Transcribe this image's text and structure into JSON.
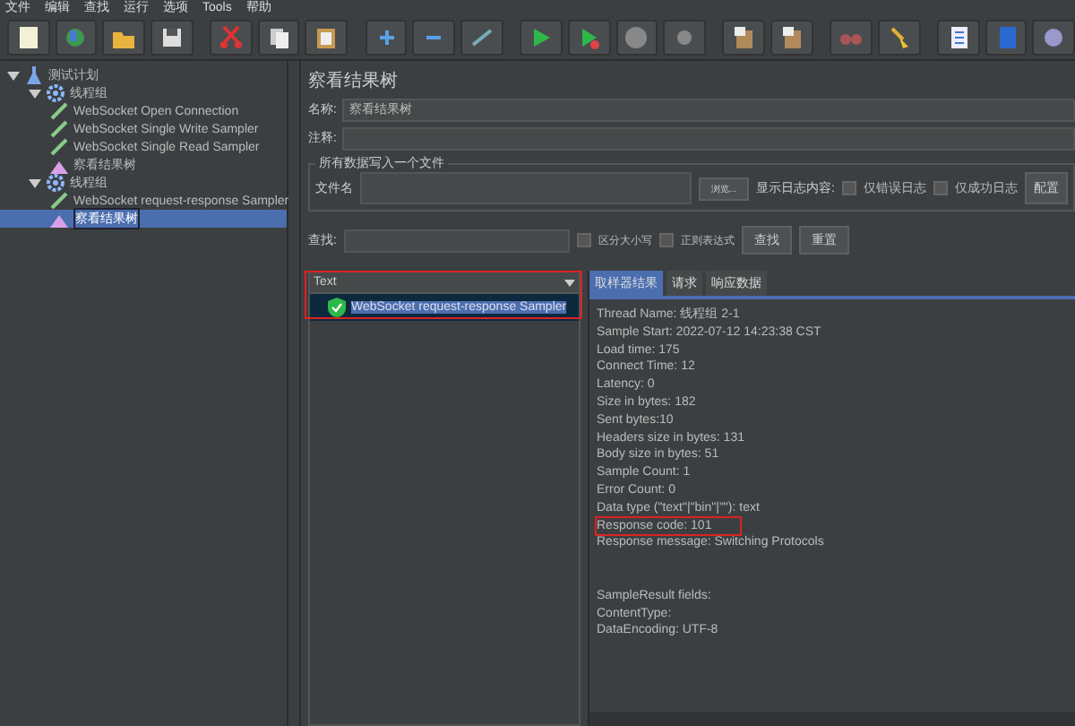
{
  "menu_bar": [
    "文件",
    "编辑",
    "查找",
    "运行",
    "选项",
    "Tools",
    "帮助"
  ],
  "tree": [
    {
      "label": "测试计划",
      "kind": "plan",
      "selected": false,
      "expanded": true,
      "children": [
        {
          "label": "线程组",
          "kind": "group",
          "selected": false,
          "expanded": true,
          "children": [
            {
              "label": "WebSocket Open Connection",
              "kind": "sampler",
              "selected": false
            },
            {
              "label": "WebSocket Single Write Sampler",
              "kind": "sampler",
              "selected": false
            },
            {
              "label": "WebSocket Single Read Sampler",
              "kind": "sampler",
              "selected": false
            },
            {
              "label": "察看结果树",
              "kind": "listener",
              "selected": false
            }
          ]
        },
        {
          "label": "线程组",
          "kind": "group",
          "selected": false,
          "expanded": true,
          "children": [
            {
              "label": "WebSocket request-response Sampler",
              "kind": "sampler",
              "selected": false
            },
            {
              "label": "察看结果树",
              "kind": "listener",
              "selected": true
            }
          ]
        }
      ]
    }
  ],
  "panel": {
    "title": "察看结果树",
    "name_label": "名称:",
    "name_value": "察看结果树",
    "comment_label": "注释:",
    "file_group": {
      "legend": "所有数据写入一个文件",
      "file_label": "文件名",
      "browse_button": "浏览...",
      "log_label": "显示日志内容:",
      "options": [
        {
          "label": "仅错误日志",
          "checked": false
        },
        {
          "label": "仅成功日志",
          "checked": false
        }
      ],
      "config_button": "配置"
    }
  },
  "search": {
    "label": "查找:",
    "options": [
      {
        "label": "区分大小写",
        "checked": false
      },
      {
        "label": "正则表达式",
        "checked": false
      }
    ],
    "find_button": "查找",
    "reset_button": "重置"
  },
  "results": {
    "renderer": "Text",
    "items": [
      {
        "label": "WebSocket request-response Sampler",
        "success": true,
        "selected": true
      }
    ]
  },
  "detail_tabs": [
    {
      "label": "取样器结果",
      "selected": true
    },
    {
      "label": "请求",
      "selected": false
    },
    {
      "label": "响应数据",
      "selected": false
    }
  ],
  "detail_lines": [
    {
      "text": "Thread Name: 线程组 2-1",
      "highlighted": false
    },
    {
      "text": "Sample Start: 2022-07-12 14:23:38 CST",
      "highlighted": false
    },
    {
      "text": "Load time: 175",
      "highlighted": false
    },
    {
      "text": "Connect Time: 12",
      "highlighted": false
    },
    {
      "text": "Latency: 0",
      "highlighted": false
    },
    {
      "text": "Size in bytes: 182",
      "highlighted": false
    },
    {
      "text": "Sent bytes:10",
      "highlighted": false
    },
    {
      "text": "Headers size in bytes: 131",
      "highlighted": false
    },
    {
      "text": "Body size in bytes: 51",
      "highlighted": false
    },
    {
      "text": "Sample Count: 1",
      "highlighted": false
    },
    {
      "text": "Error Count: 0",
      "highlighted": false
    },
    {
      "text": "Data type (\"text\"|\"bin\"|\"\"): text",
      "highlighted": false
    },
    {
      "text": "Response code: 101",
      "highlighted": true
    },
    {
      "text": "Response message: Switching Protocols",
      "highlighted": false
    }
  ],
  "sample_result_lines": [
    "SampleResult fields:",
    "ContentType:",
    "DataEncoding: UTF-8"
  ]
}
